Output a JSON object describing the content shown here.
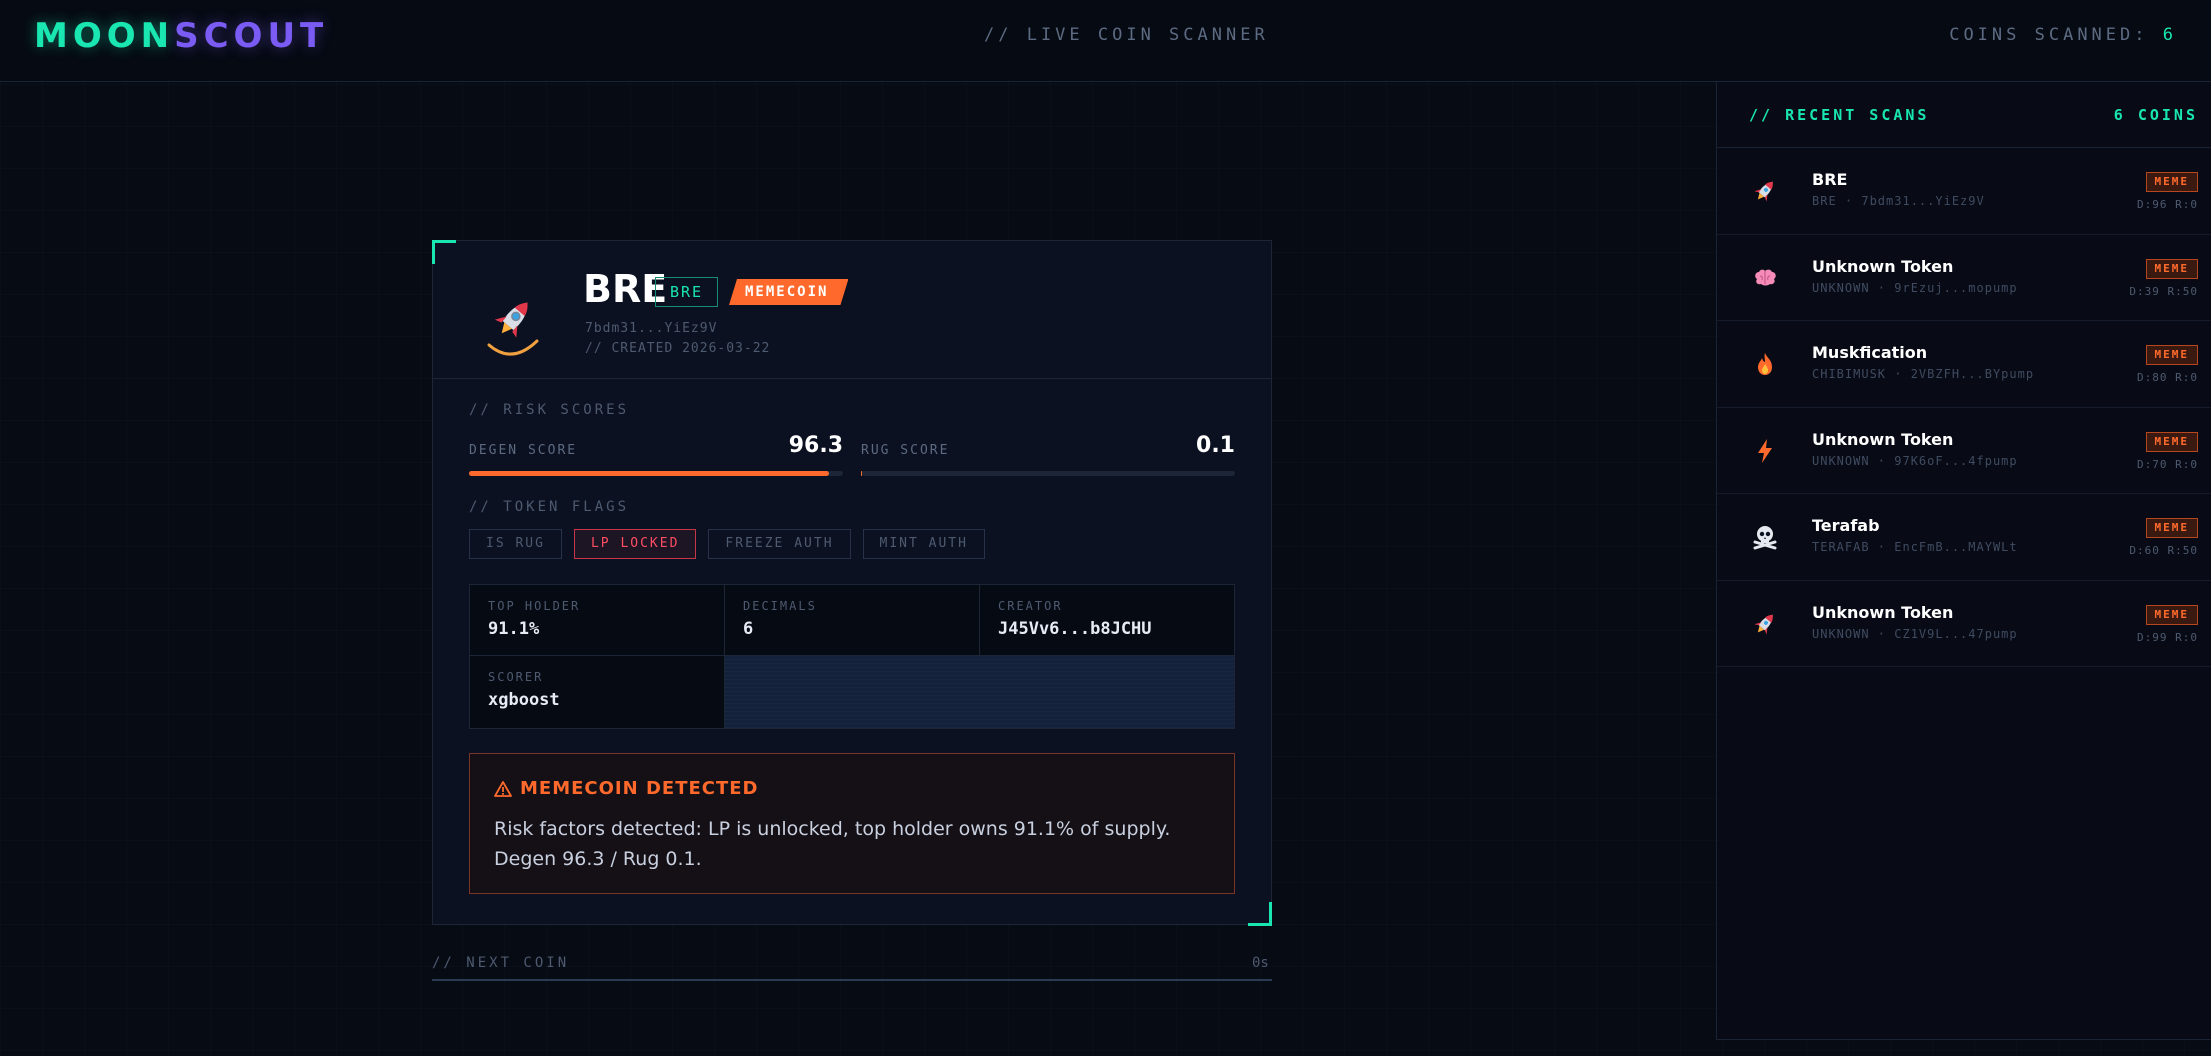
{
  "header": {
    "logo_part1": "MOON",
    "logo_part2": "SCOUT",
    "tagline": "// LIVE COIN SCANNER",
    "coins_scanned_label": "COINS SCANNED:",
    "coins_scanned_value": "6"
  },
  "coin": {
    "name": "BRE",
    "symbol": "BRE",
    "type_badge": "MEMECOIN",
    "mint": "7bdm31...YiEz9V",
    "created": "// CREATED 2026-03-22",
    "icon": "rocket-icon",
    "risk_section": "// RISK SCORES",
    "degen_label": "DEGEN SCORE",
    "degen_value": "96.3",
    "degen_fraction": 0.963,
    "rug_label": "RUG SCORE",
    "rug_value": "0.1",
    "rug_fraction": 0.001,
    "flags_section": "// TOKEN FLAGS",
    "flags": [
      {
        "label": "IS RUG",
        "active": false
      },
      {
        "label": "LP LOCKED",
        "active": true
      },
      {
        "label": "FREEZE AUTH",
        "active": false
      },
      {
        "label": "MINT AUTH",
        "active": false
      }
    ],
    "info": {
      "top_holder_label": "TOP HOLDER",
      "top_holder_value": "91.1%",
      "decimals_label": "DECIMALS",
      "decimals_value": "6",
      "creator_label": "CREATOR",
      "creator_value": "J45Vv6...b8JCHU",
      "scorer_label": "SCORER",
      "scorer_value": "xgboost"
    },
    "alert_title": "MEMECOIN DETECTED",
    "alert_text": "Risk factors detected: LP is unlocked, top holder owns 91.1% of supply. Degen 96.3 / Rug 0.1."
  },
  "next_coin": {
    "label": "// NEXT COIN",
    "time": "0s"
  },
  "sidebar": {
    "title": "// RECENT SCANS",
    "count": "6 COINS",
    "items": [
      {
        "name": "BRE",
        "sub": "BRE · 7bdm31...YiEz9V",
        "badge": "MEME",
        "scores": "D:96 R:0",
        "icon": "rocket-icon"
      },
      {
        "name": "Unknown Token",
        "sub": "UNKNOWN · 9rEzuj...mopump",
        "badge": "MEME",
        "scores": "D:39 R:50",
        "icon": "brain-icon"
      },
      {
        "name": "Muskfication",
        "sub": "CHIBIMUSK · 2VBZFH...BYpump",
        "badge": "MEME",
        "scores": "D:80 R:0",
        "icon": "fire-icon"
      },
      {
        "name": "Unknown Token",
        "sub": "UNKNOWN · 97K6oF...4fpump",
        "badge": "MEME",
        "scores": "D:70 R:0",
        "icon": "lightning-icon"
      },
      {
        "name": "Terafab",
        "sub": "TERAFAB · EncFmB...MAYWLt",
        "badge": "MEME",
        "scores": "D:60 R:50",
        "icon": "skull-crossbones-icon"
      },
      {
        "name": "Unknown Token",
        "sub": "UNKNOWN · CZ1V9L...47pump",
        "badge": "MEME",
        "scores": "D:99 R:0",
        "icon": "rocket-icon"
      }
    ]
  },
  "colors": {
    "accent": "#19e6b0",
    "accent2": "#7a5cf5",
    "warning": "#ff6a2c",
    "danger": "#ff4d63"
  }
}
